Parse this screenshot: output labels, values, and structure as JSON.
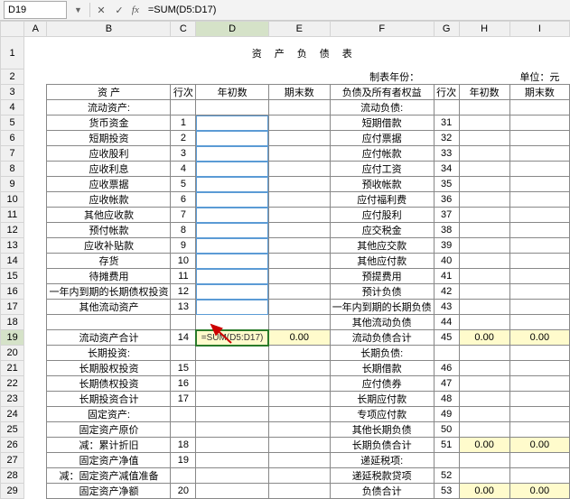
{
  "namebox": "D19",
  "formula": "=SUM(D5:D17)",
  "title": "资产负债表",
  "meta_left": "制表年份：",
  "meta_right": "单位：元",
  "hdr": {
    "asset": "资 产",
    "seq": "行次",
    "beg": "年初数",
    "end": "期末数",
    "liab": "负债及所有者权益",
    "seq2": "行次",
    "beg2": "年初数",
    "end2": "期末数"
  },
  "cols": [
    "A",
    "B",
    "C",
    "D",
    "E",
    "F",
    "G",
    "H",
    "I"
  ],
  "left": [
    {
      "b": "流动资产:",
      "c": "",
      "f": "流动负债:",
      "g": ""
    },
    {
      "b": "货币资金",
      "c": "1",
      "f": "短期借款",
      "g": "31"
    },
    {
      "b": "短期投资",
      "c": "2",
      "f": "应付票据",
      "g": "32"
    },
    {
      "b": "应收股利",
      "c": "3",
      "f": "应付帐款",
      "g": "33"
    },
    {
      "b": "应收利息",
      "c": "4",
      "f": "应付工资",
      "g": "34"
    },
    {
      "b": "应收票据",
      "c": "5",
      "f": "预收帐款",
      "g": "35"
    },
    {
      "b": "应收帐款",
      "c": "6",
      "f": "应付福利费",
      "g": "36"
    },
    {
      "b": "其他应收款",
      "c": "7",
      "f": "应付股利",
      "g": "37"
    },
    {
      "b": "预付帐款",
      "c": "8",
      "f": "应交税金",
      "g": "38"
    },
    {
      "b": "应收补贴款",
      "c": "9",
      "f": "其他应交款",
      "g": "39"
    },
    {
      "b": "存货",
      "c": "10",
      "f": "其他应付款",
      "g": "40"
    },
    {
      "b": "待摊费用",
      "c": "11",
      "f": "预提费用",
      "g": "41"
    },
    {
      "b": "一年内到期的长期债权投资",
      "c": "12",
      "f": "预计负债",
      "g": "42"
    },
    {
      "b": "其他流动资产",
      "c": "13",
      "f": "一年内到期的长期负债",
      "g": "43"
    },
    {
      "b": "",
      "c": "",
      "f": "其他流动负债",
      "g": "44"
    },
    {
      "b": "流动资产合计",
      "c": "14",
      "d": "=SUM(D5:D17)",
      "e": "0.00",
      "f": "流动负债合计",
      "g": "45",
      "h": "0.00",
      "i": "0.00",
      "sel": true
    },
    {
      "b": "长期投资:",
      "c": "",
      "f": "长期负债:",
      "g": ""
    },
    {
      "b": "长期股权投资",
      "c": "15",
      "f": "长期借款",
      "g": "46"
    },
    {
      "b": "长期债权投资",
      "c": "16",
      "f": "应付债券",
      "g": "47"
    },
    {
      "b": "长期投资合计",
      "c": "17",
      "f": "长期应付款",
      "g": "48"
    },
    {
      "b": "固定资产:",
      "c": "",
      "f": "专项应付款",
      "g": "49"
    },
    {
      "b": "固定资产原价",
      "c": "",
      "f": "其他长期负债",
      "g": "50"
    },
    {
      "b": "减：累计折旧",
      "c": "18",
      "f": "长期负债合计",
      "g": "51",
      "h": "0.00",
      "i": "0.00"
    },
    {
      "b": "固定资产净值",
      "c": "19",
      "f": "递延税项:",
      "g": ""
    },
    {
      "b": "减：固定资产减值准备",
      "c": "",
      "f": "递延税款贷项",
      "g": "52"
    },
    {
      "b": "固定资产净额",
      "c": "20",
      "f": "负债合计",
      "g": "53",
      "h": "0.00",
      "i": "0.00"
    }
  ],
  "chart_data": {
    "type": "table",
    "title": "资产负债表 (Balance Sheet template, blank)"
  }
}
